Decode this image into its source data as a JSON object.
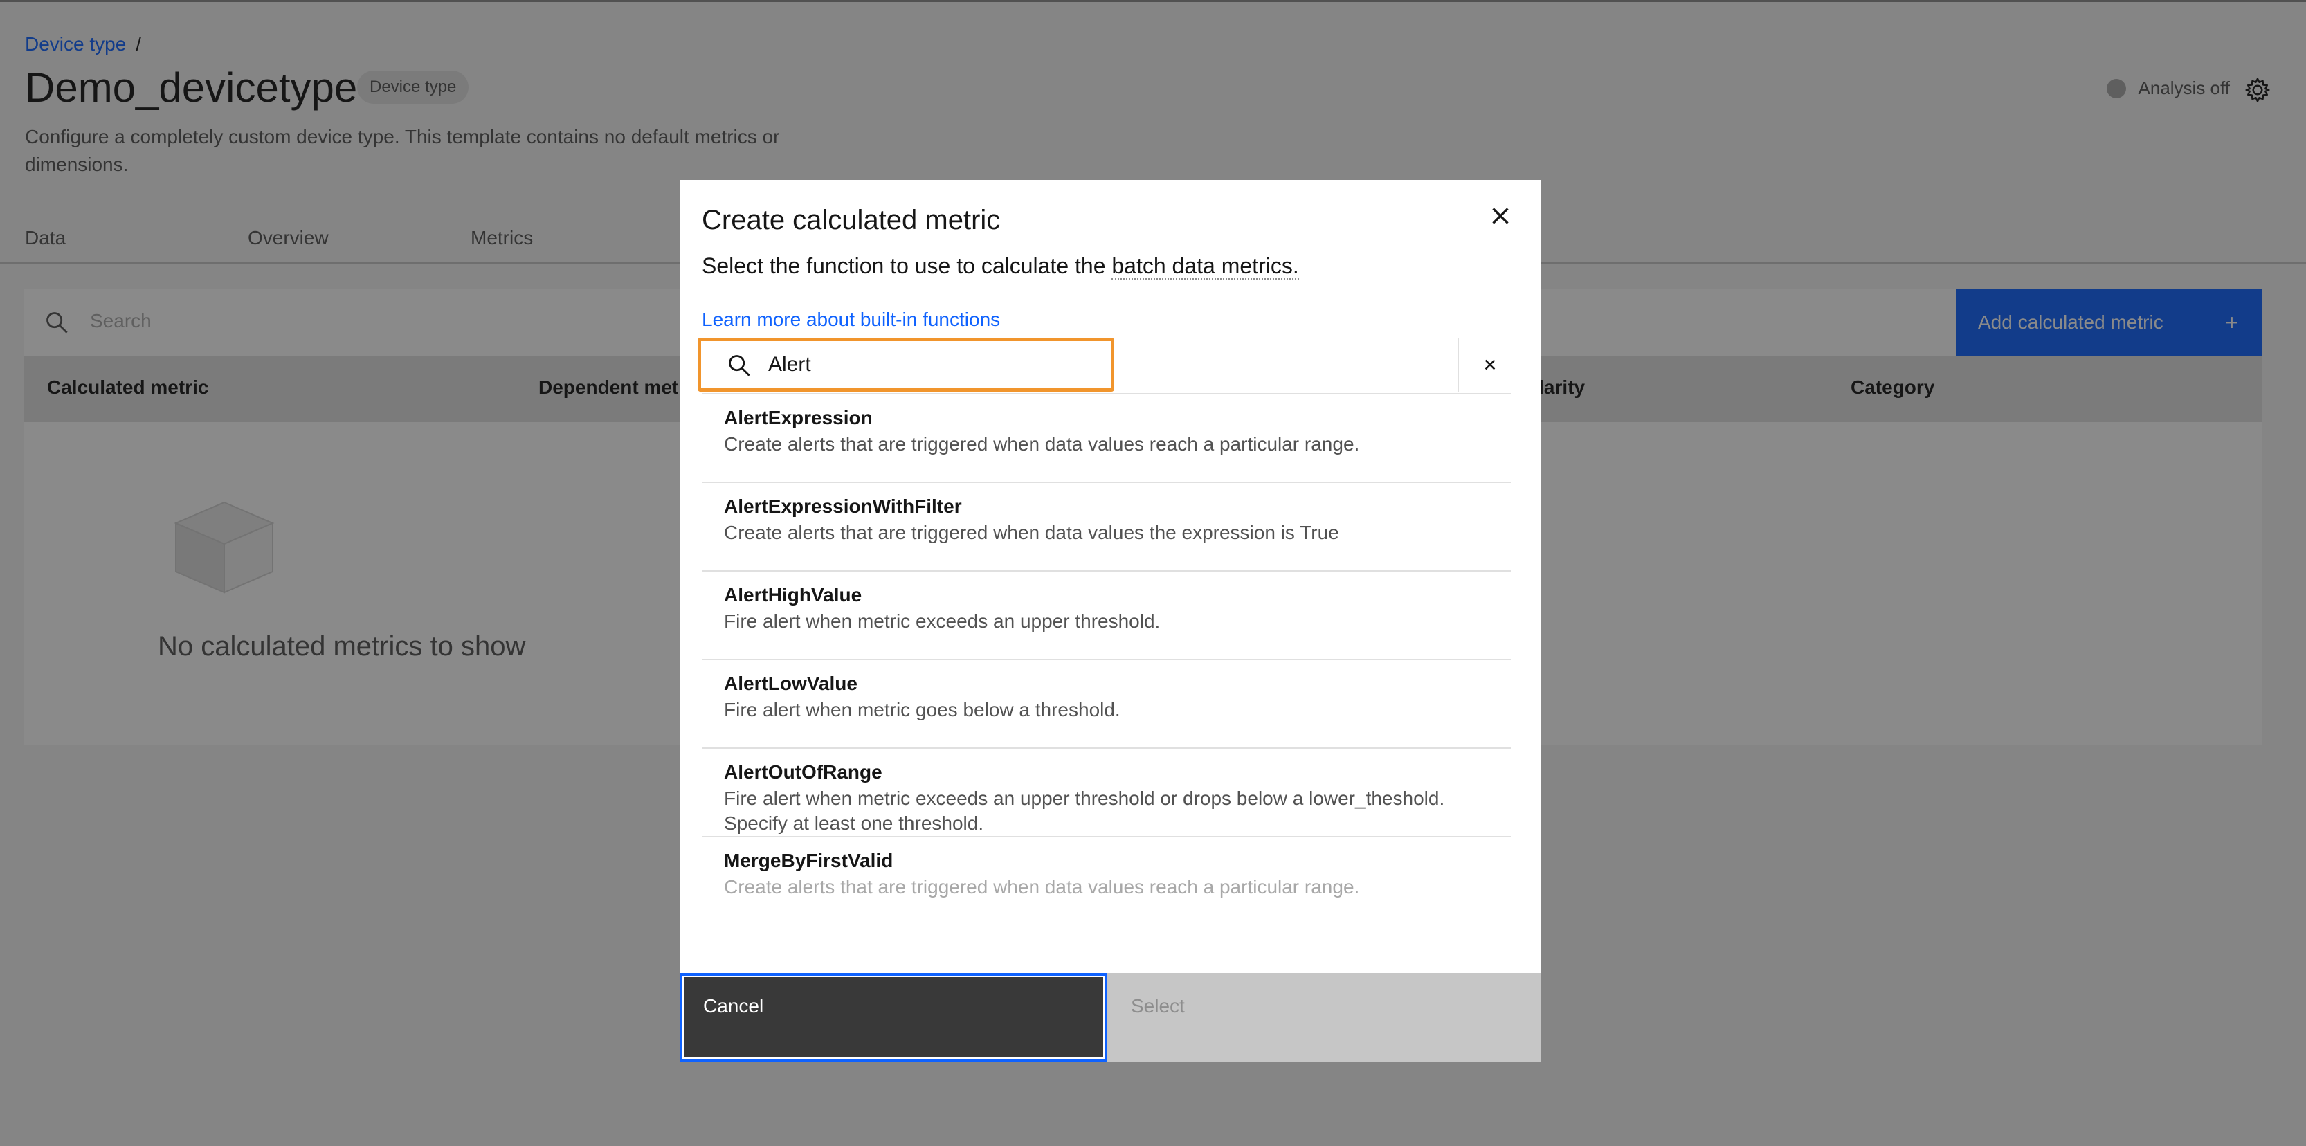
{
  "page": {
    "breadcrumb": "Device type",
    "breadcrumb_sep": "/",
    "title": "Demo_devicetype",
    "tag": "Device type",
    "description": "Configure a completely custom device type. This template contains no default metrics or dimensions.",
    "analysis_label": "Analysis off",
    "tabs": [
      "Data",
      "Overview",
      "Metrics"
    ],
    "search_placeholder": "Search",
    "add_button": "Add calculated metric",
    "table_headers": [
      "Calculated metric",
      "Dependent met",
      "ularity",
      "Category"
    ],
    "empty_state": "No calculated metrics to show"
  },
  "modal": {
    "title": "Create calculated metric",
    "subtitle_prefix": "Select the function to use to calculate the ",
    "subtitle_link": "batch data metrics.",
    "learn_more": "Learn more about built-in functions",
    "search_value": "Alert",
    "functions": [
      {
        "name": "AlertExpression",
        "desc": "Create alerts that are triggered when data values reach a particular range."
      },
      {
        "name": "AlertExpressionWithFilter",
        "desc": "Create alerts that are triggered when data values the expression is True"
      },
      {
        "name": "AlertHighValue",
        "desc": "Fire alert when metric exceeds an upper threshold."
      },
      {
        "name": "AlertLowValue",
        "desc": "Fire alert when metric goes below a threshold."
      },
      {
        "name": "AlertOutOfRange",
        "desc": "Fire alert when metric exceeds an upper threshold or drops below a lower_theshold. Specify at least one threshold."
      },
      {
        "name": "MergeByFirstValid",
        "desc": "Create alerts that are triggered when data values reach a particular range."
      }
    ],
    "cancel": "Cancel",
    "select": "Select"
  },
  "colors": {
    "accent": "#0f62fe",
    "focus_highlight": "#f1952d",
    "overlay": "#161616"
  },
  "icons": [
    "search-icon",
    "close-icon",
    "settings-icon",
    "plus-icon",
    "box-icon"
  ]
}
